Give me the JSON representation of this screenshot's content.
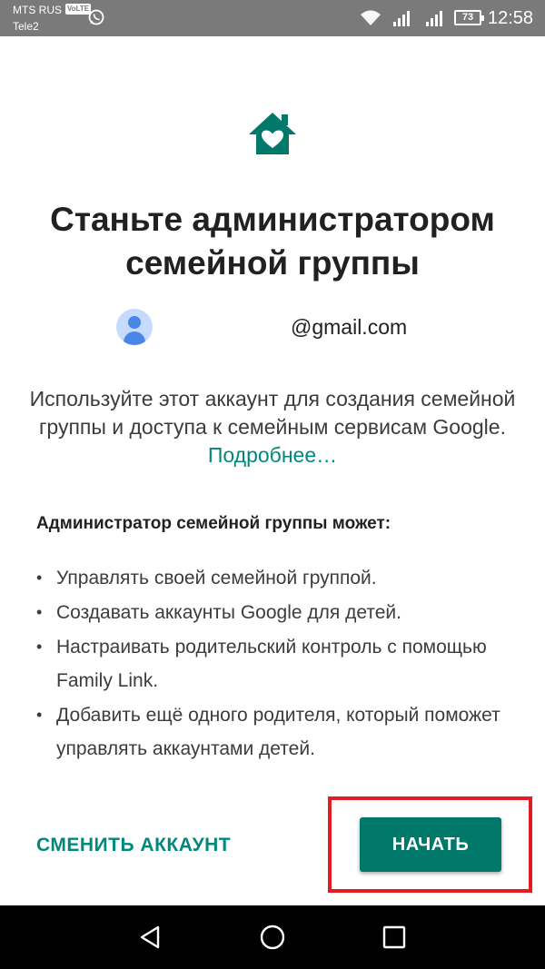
{
  "status_bar": {
    "carrier_primary": "MTS RUS",
    "volte_badge": "VoLTE",
    "carrier_secondary": "Tele2",
    "battery_level": "73",
    "time": "12:58",
    "icons": [
      "whatsapp-icon",
      "wifi-icon",
      "signal-icon",
      "signal-icon",
      "battery-icon"
    ]
  },
  "header": {
    "icon": "family-home-heart-icon",
    "title": "Станьте администратором семейной группы"
  },
  "account": {
    "email": "@gmail.com"
  },
  "description": {
    "text": "Используйте этот аккаунт для создания семейной группы и доступа к семейным сервисам Google.",
    "link_label": "Подробнее…"
  },
  "capabilities": {
    "heading": "Администратор семейной группы может:",
    "items": [
      "Управлять своей семейной группой.",
      "Создавать аккаунты Google для детей.",
      "Настраивать родительский контроль с помощью Family Link.",
      "Добавить ещё одного родителя, который поможет управлять аккаунтами детей."
    ]
  },
  "actions": {
    "switch_account_label": "СМЕНИТЬ АККАУНТ",
    "start_label": "НАЧАТЬ"
  },
  "colors": {
    "accent": "#00796b",
    "link": "#00897b",
    "highlight": "#e31c23",
    "status_bar": "#7a7a7a"
  },
  "nav_bar": {
    "icons": [
      "back-icon",
      "home-icon",
      "recent-apps-icon"
    ]
  }
}
